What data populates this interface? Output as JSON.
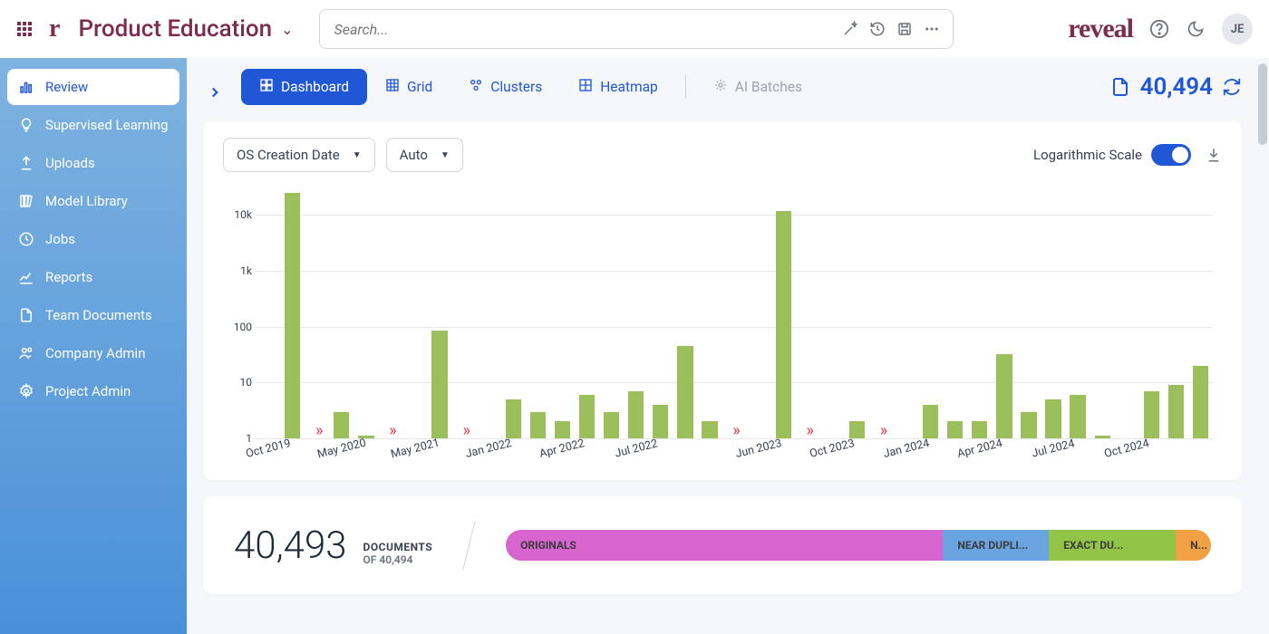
{
  "header": {
    "workspace": "Product Education",
    "search_placeholder": "Search...",
    "brand": "reveal",
    "avatar": "JE"
  },
  "sidebar": {
    "items": [
      {
        "label": "Review",
        "icon": "bar-chart-icon"
      },
      {
        "label": "Supervised Learning",
        "icon": "lightbulb-icon"
      },
      {
        "label": "Uploads",
        "icon": "upload-icon"
      },
      {
        "label": "Model Library",
        "icon": "library-icon"
      },
      {
        "label": "Jobs",
        "icon": "clock-icon"
      },
      {
        "label": "Reports",
        "icon": "line-chart-icon"
      },
      {
        "label": "Team Documents",
        "icon": "document-icon"
      },
      {
        "label": "Company Admin",
        "icon": "people-icon"
      },
      {
        "label": "Project Admin",
        "icon": "gear-icon"
      }
    ]
  },
  "tabs": {
    "items": [
      {
        "label": "Dashboard"
      },
      {
        "label": "Grid"
      },
      {
        "label": "Clusters"
      },
      {
        "label": "Heatmap"
      },
      {
        "label": "AI Batches"
      }
    ],
    "doc_count": "40,494"
  },
  "chart_card": {
    "field_dropdown": "OS Creation Date",
    "bucket_dropdown": "Auto",
    "log_scale_label": "Logarithmic Scale",
    "log_scale_on": true
  },
  "chart_data": {
    "type": "bar",
    "yscale": "log",
    "y_ticks": [
      "1",
      "10",
      "100",
      "1k",
      "10k"
    ],
    "ylim": [
      1,
      30000
    ],
    "x_labels": [
      "Oct 2019",
      "May 2020",
      "May 2021",
      "Jan 2022",
      "Apr 2022",
      "Jul 2022",
      "Jun 2023",
      "Oct 2023",
      "Jan 2024",
      "Apr 2024",
      "Jul 2024",
      "Oct 2024"
    ],
    "slots": [
      {
        "label": "Oct 2019"
      },
      {
        "value": 25000
      },
      {
        "gap": true
      },
      {
        "value": 3,
        "label": "May 2020"
      },
      {
        "value": 1.1
      },
      {
        "gap": true
      },
      {
        "label": "May 2021"
      },
      {
        "value": 85
      },
      {
        "gap": true
      },
      {
        "label": "Jan 2022"
      },
      {
        "value": 5
      },
      {
        "value": 3
      },
      {
        "value": 2,
        "label": "Apr 2022"
      },
      {
        "value": 6
      },
      {
        "value": 3
      },
      {
        "value": 7,
        "label": "Jul 2022"
      },
      {
        "value": 4
      },
      {
        "value": 45
      },
      {
        "value": 2
      },
      {
        "gap": true
      },
      {
        "label": "Jun 2023"
      },
      {
        "value": 12000
      },
      {
        "gap": true
      },
      {
        "label": "Oct 2023"
      },
      {
        "value": 2
      },
      {
        "gap": true
      },
      {
        "label": "Jan 2024"
      },
      {
        "value": 4
      },
      {
        "value": 2
      },
      {
        "value": 2,
        "label": "Apr 2024"
      },
      {
        "value": 32
      },
      {
        "value": 3
      },
      {
        "value": 5,
        "label": "Jul 2024"
      },
      {
        "value": 6
      },
      {
        "value": 1.1
      },
      {
        "label": "Oct 2024"
      },
      {
        "value": 7
      },
      {
        "value": 9
      },
      {
        "value": 20
      }
    ]
  },
  "summary": {
    "big_number": "40,493",
    "documents_label": "DOCUMENTS",
    "of_total": "OF 40,494",
    "segments": [
      {
        "label": "ORIGINALS",
        "color": "#d764cf",
        "pct": 62
      },
      {
        "label": "NEAR DUPLI...",
        "color": "#6aa4e0",
        "pct": 15
      },
      {
        "label": "EXACT DU...",
        "color": "#92c448",
        "pct": 18
      },
      {
        "label": "N...",
        "color": "#f2a044",
        "pct": 5
      }
    ]
  }
}
